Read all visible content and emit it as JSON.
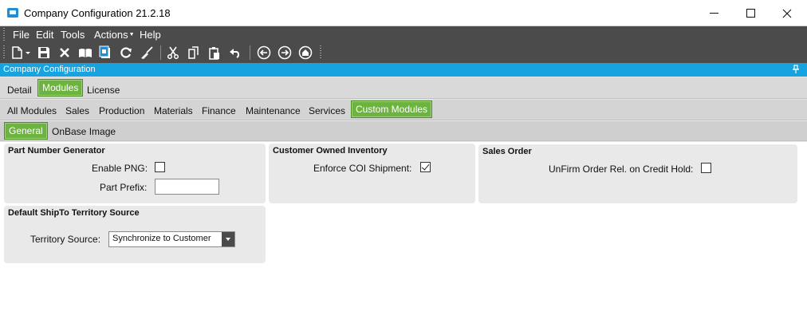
{
  "window": {
    "title": "Company Configuration 21.2.18"
  },
  "menu": {
    "items": [
      "File",
      "Edit",
      "Tools",
      "Actions",
      "Help"
    ]
  },
  "toolbar": {
    "icons": [
      "new-icon",
      "save-icon",
      "delete-icon",
      "book-icon",
      "attachment-icon",
      "refresh-icon",
      "clear-icon",
      "cut-icon",
      "copy-icon",
      "paste-icon",
      "undo-icon",
      "back-icon",
      "forward-icon",
      "home-icon"
    ]
  },
  "panel": {
    "title": "Company Configuration"
  },
  "tabs": {
    "level1": [
      "Detail",
      "Modules",
      "License"
    ],
    "level1_active": "Modules",
    "level2": [
      "All Modules",
      "Sales",
      "Production",
      "Materials",
      "Finance",
      "Maintenance",
      "Services",
      "Custom Modules"
    ],
    "level2_active": "Custom Modules",
    "level3": [
      "General",
      "OnBase Image"
    ],
    "level3_active": "General"
  },
  "groups": {
    "part_number": {
      "title": "Part Number Generator",
      "enable_png_label": "Enable PNG:",
      "enable_png_checked": false,
      "part_prefix_label": "Part Prefix:",
      "part_prefix_value": ""
    },
    "coi": {
      "title": "Customer Owned Inventory",
      "enforce_label": "Enforce COI Shipment:",
      "enforce_checked": true
    },
    "sales_order": {
      "title": "Sales Order",
      "unfirm_label": "UnFirm Order Rel. on Credit Hold:",
      "unfirm_checked": false
    },
    "territory": {
      "title": "Default ShipTo Territory Source",
      "source_label": "Territory Source:",
      "source_value": "Synchronize to Customer"
    }
  },
  "colors": {
    "accent_blue": "#17a2e0",
    "tab_green": "#6cb33f",
    "toolbar_dark": "#4b4b4b"
  }
}
